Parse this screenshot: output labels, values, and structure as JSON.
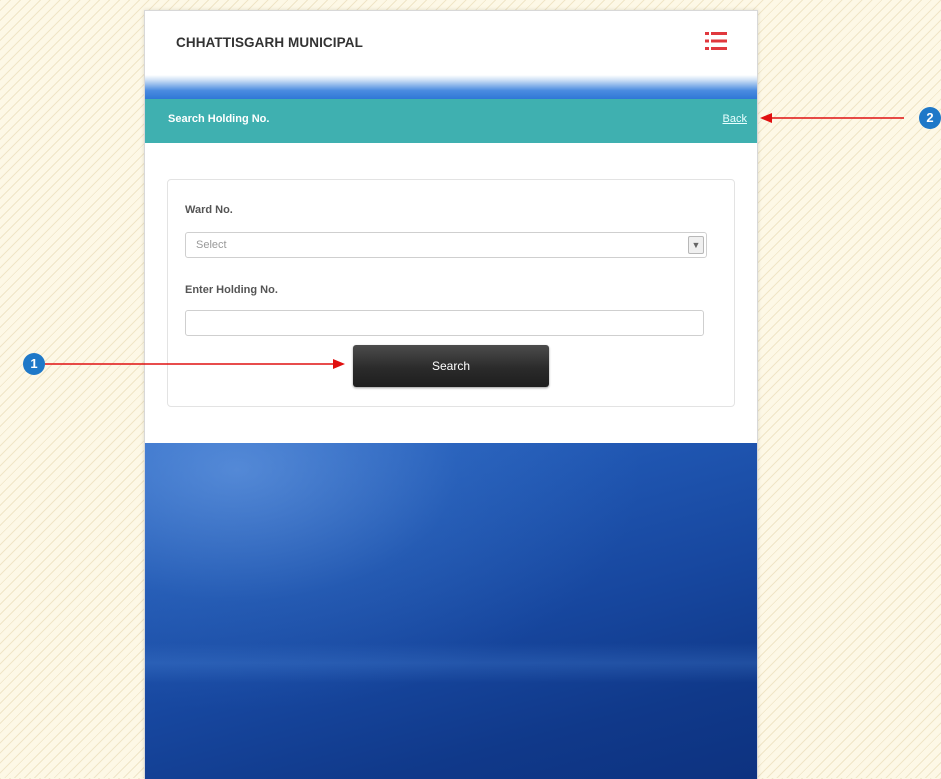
{
  "header": {
    "brand": "CHHATTISGARH MUNICIPAL",
    "menu_icon": "hamburger-list-icon",
    "menu_icon_color": "#e0383e"
  },
  "subheader": {
    "title": "Search Holding No.",
    "back_label": "Back",
    "background": "#3fb0b0"
  },
  "form": {
    "ward_label": "Ward No.",
    "ward_select_value": "Select",
    "holding_label": "Enter Holding No.",
    "holding_value": "",
    "search_button": "Search"
  },
  "annotations": {
    "marker_1": "1",
    "marker_2": "2",
    "arrow_color": "#e01010"
  }
}
